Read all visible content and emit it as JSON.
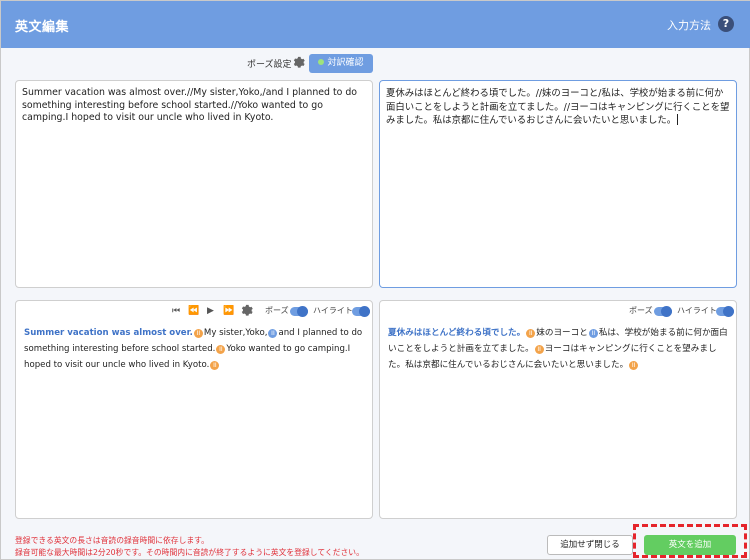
{
  "header": {
    "title": "英文編集",
    "input_method": "入力方法",
    "help": "?"
  },
  "toolbar": {
    "pause_settings": "ポーズ設定",
    "compare_button": "対訳確認"
  },
  "editor": {
    "english_text": "Summer vacation was almost over.//My sister,Yoko,/and I planned to do something interesting before school started.//Yoko wanted to go camping.I hoped to visit our uncle who lived in Kyoto.",
    "japanese_text": "夏休みはほとんど終わる頃でした。//妹のヨーコと/私は、学校が始まる前に何か面白いことをしようと計画を立てました。//ヨーコはキャンピングに行くことを望みました。私は京都に住んでいるおじさんに会いたいと思いました。"
  },
  "preview_en": {
    "pause_label": "ポーズ",
    "highlight_label": "ハイライト",
    "seg1": "Summer vacation was almost over.",
    "seg2": "My sister,Yoko,",
    "seg3": "and I planned to do something interesting before school started.",
    "seg4": "Yoko wanted to go camping.I hoped to visit our uncle who lived in Kyoto."
  },
  "preview_ja": {
    "pause_label": "ポーズ",
    "highlight_label": "ハイライト",
    "seg1": "夏休みはほとんど終わる頃でした。",
    "seg2": "妹のヨーコと",
    "seg3": "私は、学校が始まる前に何か面白いことをしようと計画を立てました。",
    "seg4": "ヨーコはキャンピングに行くことを望みました。私は京都に住んでいるおじさんに会いたいと思いました。"
  },
  "pause_marks": {
    "long": "II",
    "short": "II"
  },
  "footer": {
    "notice_line1": "登録できる英文の長さは音読の録音時間に依存します。",
    "notice_line2": "録音可能な最大時間は2分20秒です。その時間内に音読が終了するように英文を登録してください。",
    "close_button": "追加せず閉じる",
    "add_button": "英文を追加"
  },
  "colors": {
    "accent": "#6f9de1",
    "highlight_text": "#3f73c7",
    "long_pause": "#f3a34a",
    "short_pause": "#6f9de1",
    "add_button": "#63cd61",
    "notice": "#e0313a"
  }
}
